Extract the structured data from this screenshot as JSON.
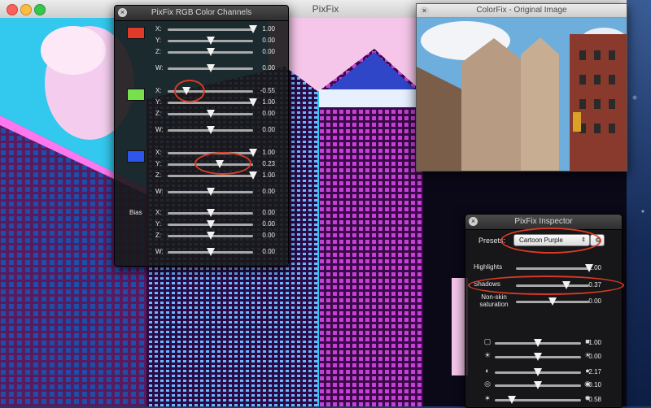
{
  "main": {
    "title": "PixFix"
  },
  "channels": {
    "title": "PixFix RGB Color Channels",
    "groups": [
      {
        "name": "red",
        "color": "#e03a2a",
        "rows": [
          {
            "label": "X:",
            "value": "1.00",
            "level": 1.0
          },
          {
            "label": "Y:",
            "value": "0.00",
            "level": 0.5
          },
          {
            "label": "Z:",
            "value": "0.00",
            "level": 0.5
          },
          {
            "label": "W:",
            "value": "0.00",
            "level": 0.5
          }
        ]
      },
      {
        "name": "green",
        "color": "#78e04a",
        "rows": [
          {
            "label": "X:",
            "value": "-0.55",
            "level": 0.22
          },
          {
            "label": "Y:",
            "value": "1.00",
            "level": 1.0
          },
          {
            "label": "Z:",
            "value": "0.00",
            "level": 0.5
          },
          {
            "label": "W:",
            "value": "0.00",
            "level": 0.5
          }
        ]
      },
      {
        "name": "blue",
        "color": "#2f56ea",
        "rows": [
          {
            "label": "X:",
            "value": "1.00",
            "level": 1.0
          },
          {
            "label": "Y:",
            "value": "0.23",
            "level": 0.61
          },
          {
            "label": "Z:",
            "value": "1.00",
            "level": 1.0
          },
          {
            "label": "W:",
            "value": "0.00",
            "level": 0.5
          }
        ]
      }
    ],
    "bias": {
      "label": "Bias",
      "rows": [
        {
          "label": "X:",
          "value": "0.00",
          "level": 0.5
        },
        {
          "label": "Y:",
          "value": "0.00",
          "level": 0.5
        },
        {
          "label": "Z:",
          "value": "0.00",
          "level": 0.5
        },
        {
          "label": "W:",
          "value": "0.00",
          "level": 0.5
        }
      ]
    }
  },
  "original": {
    "title": "ColorFix - Original Image"
  },
  "inspector": {
    "title": "PixFix Inspector",
    "presets_label": "Presets:",
    "preset_value": "Cartoon Purple",
    "rows": [
      {
        "label": "Highlights",
        "value": "1.00",
        "level": 1.0
      },
      {
        "label": "Shadows",
        "value": "0.37",
        "level": 0.69
      },
      {
        "label": "Non-skin saturation",
        "value": "0.00",
        "level": 0.5
      }
    ],
    "adjust_rows": [
      {
        "value": "1.00",
        "level": 0.5,
        "icon_l": "brightness-icon",
        "icon_r": "color-icon"
      },
      {
        "value": "0.00",
        "level": 0.5,
        "icon_l": "sun-small-icon",
        "icon_r": "sun-large-icon"
      },
      {
        "value": "2.17",
        "level": 0.5,
        "icon_l": "contrast-icon",
        "icon_r": "contrast-high-icon"
      },
      {
        "value": "0.10",
        "level": 0.5,
        "icon_l": "saturation-icon",
        "icon_r": "saturation-high-icon"
      },
      {
        "value": "0.58",
        "level": 0.2,
        "icon_l": "exposure-icon",
        "icon_r": "exposure-high-icon"
      }
    ]
  }
}
